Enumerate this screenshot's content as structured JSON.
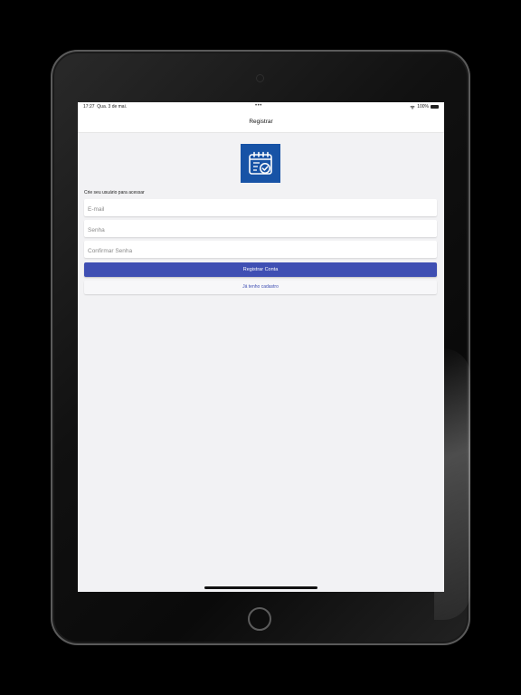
{
  "status_bar": {
    "time": "17:27",
    "date": "Qua. 3 de mai.",
    "dots": "•••",
    "battery": "100%"
  },
  "nav": {
    "title": "Registrar"
  },
  "form": {
    "caption": "Crie seu usuário para acessar",
    "email_placeholder": "E-mail",
    "password_placeholder": "Senha",
    "confirm_placeholder": "Confirmar Senha",
    "register_label": "Registrar Conta",
    "login_label": "Já tenho cadastro"
  },
  "icons": {
    "logo": "calendar-check-icon",
    "wifi": "wifi-icon",
    "battery": "battery-icon"
  },
  "colors": {
    "logo_bg": "#1753a6",
    "primary_button": "#3f4fb3",
    "screen_bg": "#f2f2f4"
  }
}
